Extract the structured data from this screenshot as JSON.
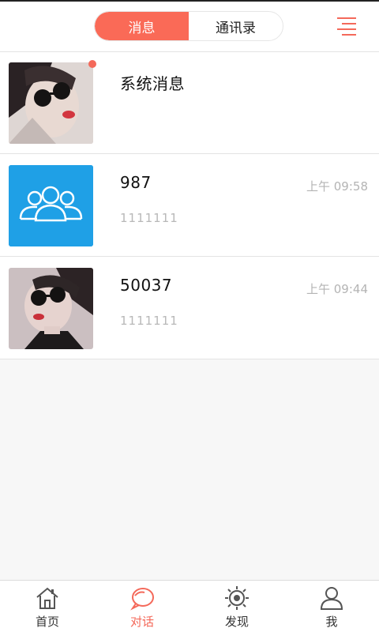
{
  "header": {
    "tabs": [
      {
        "label": "消息",
        "active": true
      },
      {
        "label": "通讯录",
        "active": false
      }
    ],
    "menu_icon": "menu-lines-icon"
  },
  "conversations": [
    {
      "title": "系统消息",
      "time": "",
      "preview": "",
      "avatar": "photo-avatar-sunglasses",
      "unread": true
    },
    {
      "title": "987",
      "time": "上午 09:58",
      "preview": "1111111",
      "avatar": "group-icon",
      "unread": false
    },
    {
      "title": "50037",
      "time": "上午 09:44",
      "preview": "1111111",
      "avatar": "photo-avatar-sunglasses",
      "unread": false
    }
  ],
  "tabbar": [
    {
      "label": "首页",
      "icon": "home-icon",
      "active": false
    },
    {
      "label": "对话",
      "icon": "chat-bubble-icon",
      "active": true
    },
    {
      "label": "发现",
      "icon": "discover-icon",
      "active": false
    },
    {
      "label": "我",
      "icon": "person-icon",
      "active": false
    }
  ],
  "colors": {
    "accent": "#fa6a57",
    "group_avatar_bg": "#1fa0e6",
    "muted_text": "#b4b4b4"
  }
}
